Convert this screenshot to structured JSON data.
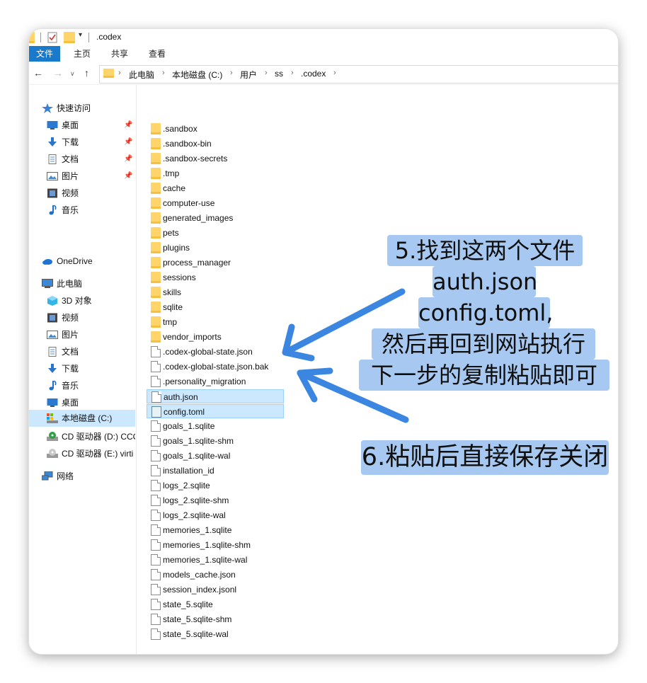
{
  "window": {
    "title": ".codex",
    "quick_access_dropdown": "▾",
    "colors": {
      "accent": "#1979ca",
      "selection": "#cce8ff",
      "annotation": "#a7c8f0",
      "arrow": "#3b86e0"
    }
  },
  "ribbon": {
    "tabs": [
      "文件",
      "主页",
      "共享",
      "查看"
    ]
  },
  "address": {
    "nav_back": "←",
    "nav_forward": "→",
    "nav_recent": "∨",
    "nav_up": "↑",
    "separator": "›",
    "crumbs": [
      "此电脑",
      "本地磁盘 (C:)",
      "用户",
      "ss",
      ".codex"
    ]
  },
  "sidebar": {
    "quick_access": {
      "label": "快速访问",
      "icon": "star-icon"
    },
    "quick_items": [
      {
        "label": "桌面",
        "icon": "desktop-icon",
        "pinned": true
      },
      {
        "label": "下载",
        "icon": "download-icon",
        "pinned": true
      },
      {
        "label": "文档",
        "icon": "document-icon",
        "pinned": true
      },
      {
        "label": "图片",
        "icon": "pictures-icon",
        "pinned": true
      },
      {
        "label": "视频",
        "icon": "video-icon",
        "pinned": false
      },
      {
        "label": "音乐",
        "icon": "music-icon",
        "pinned": false
      }
    ],
    "pin_glyph": "📌",
    "onedrive": {
      "label": "OneDrive",
      "icon": "cloud-icon"
    },
    "this_pc": {
      "label": "此电脑",
      "icon": "computer-icon"
    },
    "pc_items": [
      {
        "label": "3D 对象",
        "icon": "3d-objects-icon"
      },
      {
        "label": "视频",
        "icon": "video-icon"
      },
      {
        "label": "图片",
        "icon": "pictures-icon"
      },
      {
        "label": "文档",
        "icon": "document-icon"
      },
      {
        "label": "下载",
        "icon": "download-icon"
      },
      {
        "label": "音乐",
        "icon": "music-icon"
      },
      {
        "label": "桌面",
        "icon": "desktop-icon"
      },
      {
        "label": "本地磁盘 (C:)",
        "icon": "local-disk-icon",
        "selected": true
      },
      {
        "label": "CD 驱动器 (D:) CCC",
        "icon": "cd-drive-icon"
      },
      {
        "label": "CD 驱动器 (E:) virti",
        "icon": "cd-drive-icon"
      }
    ],
    "network": {
      "label": "网络",
      "icon": "network-icon"
    }
  },
  "files": [
    {
      "name": ".sandbox",
      "type": "folder"
    },
    {
      "name": ".sandbox-bin",
      "type": "folder"
    },
    {
      "name": ".sandbox-secrets",
      "type": "folder"
    },
    {
      "name": ".tmp",
      "type": "folder"
    },
    {
      "name": "cache",
      "type": "folder"
    },
    {
      "name": "computer-use",
      "type": "folder"
    },
    {
      "name": "generated_images",
      "type": "folder"
    },
    {
      "name": "pets",
      "type": "folder"
    },
    {
      "name": "plugins",
      "type": "folder"
    },
    {
      "name": "process_manager",
      "type": "folder"
    },
    {
      "name": "sessions",
      "type": "folder"
    },
    {
      "name": "skills",
      "type": "folder"
    },
    {
      "name": "sqlite",
      "type": "folder"
    },
    {
      "name": "tmp",
      "type": "folder"
    },
    {
      "name": "vendor_imports",
      "type": "folder"
    },
    {
      "name": ".codex-global-state.json",
      "type": "file"
    },
    {
      "name": ".codex-global-state.json.bak",
      "type": "file"
    },
    {
      "name": ".personality_migration",
      "type": "file"
    },
    {
      "name": "auth.json",
      "type": "file",
      "selected": true
    },
    {
      "name": "config.toml",
      "type": "config",
      "selected": true
    },
    {
      "name": "goals_1.sqlite",
      "type": "file"
    },
    {
      "name": "goals_1.sqlite-shm",
      "type": "file"
    },
    {
      "name": "goals_1.sqlite-wal",
      "type": "file"
    },
    {
      "name": "installation_id",
      "type": "file"
    },
    {
      "name": "logs_2.sqlite",
      "type": "file"
    },
    {
      "name": "logs_2.sqlite-shm",
      "type": "file"
    },
    {
      "name": "logs_2.sqlite-wal",
      "type": "file"
    },
    {
      "name": "memories_1.sqlite",
      "type": "file"
    },
    {
      "name": "memories_1.sqlite-shm",
      "type": "file"
    },
    {
      "name": "memories_1.sqlite-wal",
      "type": "file"
    },
    {
      "name": "models_cache.json",
      "type": "file"
    },
    {
      "name": "session_index.jsonl",
      "type": "file"
    },
    {
      "name": "state_5.sqlite",
      "type": "file"
    },
    {
      "name": "state_5.sqlite-shm",
      "type": "file"
    },
    {
      "name": "state_5.sqlite-wal",
      "type": "file"
    }
  ],
  "annotations": {
    "step5": [
      "5.找到这两个文件",
      "auth.json",
      "config.toml,",
      "然后再回到网站执行",
      "下一步的复制粘贴即可"
    ],
    "step6": "6.粘贴后直接保存关闭"
  }
}
